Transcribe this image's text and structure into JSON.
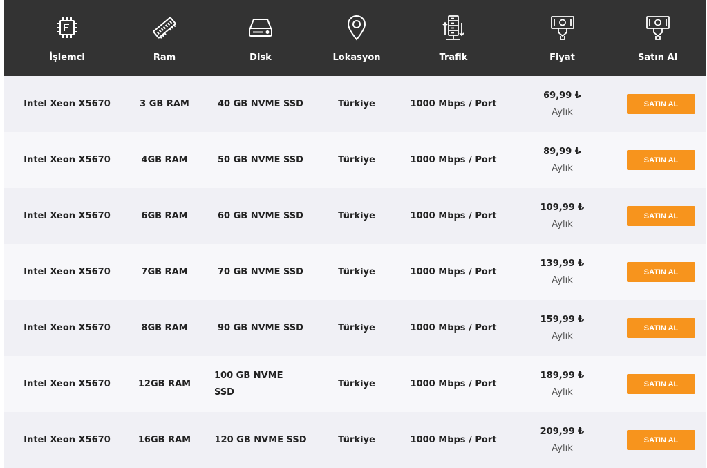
{
  "header": {
    "columns": [
      {
        "label": "İşlemci",
        "icon": "cpu-icon"
      },
      {
        "label": "Ram",
        "icon": "ram-icon"
      },
      {
        "label": "Disk",
        "icon": "disk-icon"
      },
      {
        "label": "Lokasyon",
        "icon": "location-pin-icon"
      },
      {
        "label": "Trafik",
        "icon": "server-traffic-icon"
      },
      {
        "label": "Fiyat",
        "icon": "money-hand-icon"
      },
      {
        "label": "Satın Al",
        "icon": "money-hand-icon"
      }
    ]
  },
  "plans": [
    {
      "cpu": "Intel Xeon X5670",
      "ram": "3 GB RAM",
      "disk": "40 GB NVME SSD",
      "location": "Türkiye",
      "traffic": "1000 Mbps / Port",
      "price": "69,99 ₺",
      "period": "Aylık",
      "buy": "SATIN AL"
    },
    {
      "cpu": "Intel Xeon X5670",
      "ram": "4GB RAM",
      "disk": "50 GB NVME SSD",
      "location": "Türkiye",
      "traffic": "1000 Mbps / Port",
      "price": "89,99 ₺",
      "period": "Aylık",
      "buy": "SATIN AL"
    },
    {
      "cpu": "Intel Xeon X5670",
      "ram": "6GB RAM",
      "disk": "60 GB NVME SSD",
      "location": "Türkiye",
      "traffic": "1000 Mbps / Port",
      "price": "109,99 ₺",
      "period": "Aylık",
      "buy": "SATIN AL"
    },
    {
      "cpu": "Intel Xeon X5670",
      "ram": "7GB RAM",
      "disk": "70 GB NVME SSD",
      "location": "Türkiye",
      "traffic": "1000 Mbps / Port",
      "price": "139,99 ₺",
      "period": "Aylık",
      "buy": "SATIN AL"
    },
    {
      "cpu": "Intel Xeon X5670",
      "ram": "8GB RAM",
      "disk": "90 GB NVME SSD",
      "location": "Türkiye",
      "traffic": "1000 Mbps / Port",
      "price": "159,99 ₺",
      "period": "Aylık",
      "buy": "SATIN AL"
    },
    {
      "cpu": "Intel Xeon X5670",
      "ram": "12GB RAM",
      "disk": "100 GB NVME SSD",
      "location": "Türkiye",
      "traffic": "1000 Mbps / Port",
      "price": "189,99 ₺",
      "period": "Aylık",
      "buy": "SATIN AL"
    },
    {
      "cpu": "Intel Xeon X5670",
      "ram": "16GB RAM",
      "disk": "120 GB NVME SSD",
      "location": "Türkiye",
      "traffic": "1000 Mbps / Port",
      "price": "209,99 ₺",
      "period": "Aylık",
      "buy": "SATIN AL"
    }
  ],
  "colors": {
    "header_bg": "#333333",
    "button": "#f7941d",
    "row_odd": "#f0f0f5",
    "row_even": "#f7f7fa"
  }
}
